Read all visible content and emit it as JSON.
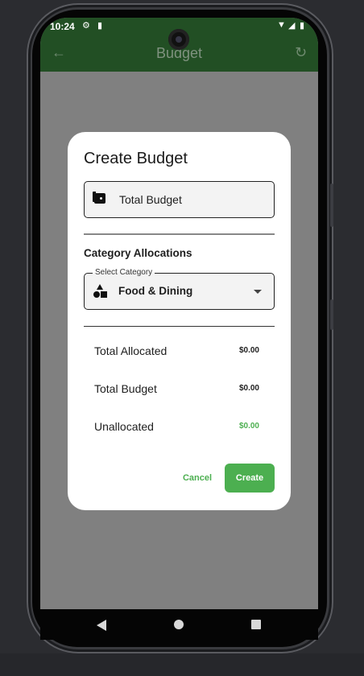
{
  "status_bar": {
    "time": "10:24",
    "icons": [
      "gear-icon",
      "sd-card-icon",
      "wifi-icon",
      "signal-icon",
      "battery-icon"
    ]
  },
  "app_bar": {
    "title": "Budget",
    "back_icon": "arrow-back-icon",
    "refresh_icon": "refresh-icon",
    "color": "#224f24"
  },
  "dialog": {
    "title": "Create Budget",
    "total_budget_field": {
      "icon": "wallet-icon",
      "placeholder": "Total Budget"
    },
    "category_section_label": "Category Allocations",
    "category_select": {
      "floating_label": "Select Category",
      "icon": "category-shapes-icon",
      "value": "Food & Dining"
    },
    "summary": [
      {
        "label": "Total Allocated",
        "value": "$0.00"
      },
      {
        "label": "Total Budget",
        "value": "$0.00"
      },
      {
        "label": "Unallocated",
        "value": "$0.00"
      }
    ],
    "buttons": {
      "cancel": "Cancel",
      "create": "Create"
    },
    "accent_color": "#4caf50"
  },
  "nav_bar": {
    "icons": [
      "nav-back-icon",
      "nav-home-icon",
      "nav-recents-icon"
    ]
  }
}
